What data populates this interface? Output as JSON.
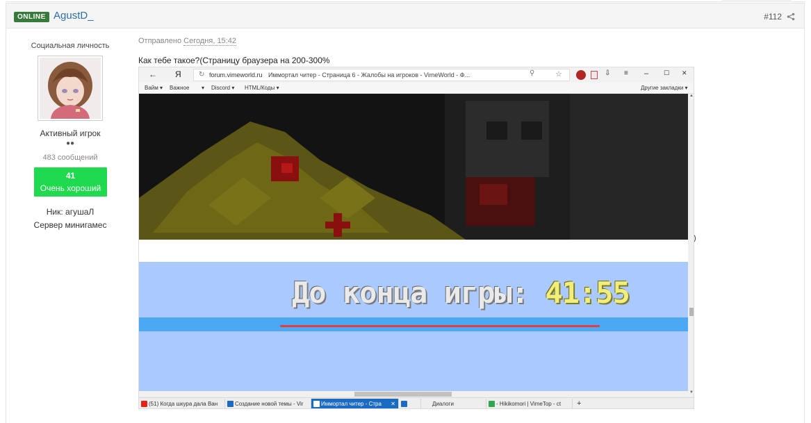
{
  "header": {
    "status_badge": "ONLINE",
    "author": "AgustD_",
    "post_number": "#112"
  },
  "author_panel": {
    "user_title": "Социальная личность",
    "rank": "Активный игрок",
    "rank_dots": "●●",
    "post_count": "483 сообщений",
    "reputation_value": "41",
    "reputation_label": "Очень хороший",
    "nick": "Ник: агушаЛ",
    "server": "Сервер минигамес"
  },
  "post": {
    "meta_prefix": "Отправлено",
    "meta_date": "Сегодня, 15:42",
    "text": "Как тебе такое?(Страницу браузера на 200-300%",
    "trailing_paren": ")"
  },
  "screenshot": {
    "back": "←",
    "ya": "Я",
    "reload": "↻",
    "host": "forum.vimeworld.ru",
    "page_title": "Иммортал читер - Страница 6 - Жалобы на игроков - VimeWorld - Ф...",
    "menu_icons": [
      "⚲",
      "☆",
      "⇩",
      "≡",
      "–",
      "☐",
      "✕"
    ],
    "bookmarks": [
      "Вайм ▾",
      "Важное",
      "▾",
      "Discord ▾",
      "HTML/Коды ▾"
    ],
    "bookmarks_other": "Другие закладки ▾",
    "timer_label": "До конца игры:",
    "timer_value": "41:55",
    "taskbar_tabs": [
      {
        "label": "(51) Когда шкура дала Ван",
        "color": "#e62117"
      },
      {
        "label": "Создание новой темы - Vir",
        "color": "#1b6bc2"
      },
      {
        "label": "Иммортал читер - Стра",
        "color": "#1b6bc2",
        "active": true
      },
      {
        "label": "",
        "color": "#1b6bc2"
      },
      {
        "label": "Диалоги",
        "color": "#ffffff"
      },
      {
        "label": "- Hikikomori | VimeTop - ct",
        "color": "#2fa84f"
      },
      {
        "label": "+",
        "color": "#eeeeee"
      }
    ],
    "tab_close": "✕"
  },
  "colors": {
    "online_badge": "#377b3a",
    "author_link": "#2b6ea8",
    "reputation_bg": "#1fda4f",
    "game_bottom_bg": "#a9c9ff",
    "underline": "#e83b3b"
  }
}
